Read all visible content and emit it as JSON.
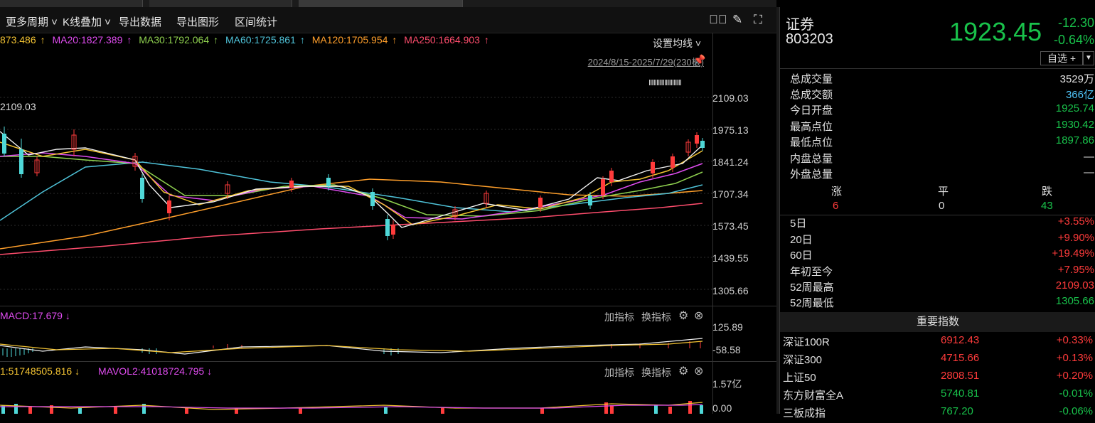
{
  "toolbar": {
    "items": [
      "更多周期",
      "K线叠加",
      "导出数据",
      "导出图形",
      "区间统计"
    ],
    "icons": [
      "chevron-circle-icon",
      "brush-icon",
      "expand-icon"
    ]
  },
  "ma": {
    "ma10": "873.486",
    "ma20": "MA20:1827.389",
    "ma30": "MA30:1792.064",
    "ma60": "MA60:1725.861",
    "ma120": "MA120:1705.954",
    "ma250": "MA250:1664.903",
    "setting": "设置均线",
    "colors": {
      "ma10": "#f2c232",
      "ma20": "#e04cf0",
      "ma30": "#8fd14f",
      "ma60": "#4fc3d9",
      "ma120": "#ff9f2b",
      "ma250": "#ff4d6d"
    }
  },
  "range_label": "2024/8/15-2025/7/29(230根)",
  "high_marker": "2109.03",
  "y_ticks": [
    "2109.03",
    "1975.13",
    "1841.24",
    "1707.34",
    "1573.45",
    "1439.55",
    "1305.66"
  ],
  "macd": {
    "label": "MACD:17.679",
    "arrow": "↓",
    "ticks": [
      "125.89",
      "-58.58"
    ]
  },
  "vol": {
    "label1": "1:51748505.816",
    "label2": "MAVOL2:41018724.795",
    "ticks": [
      "1.57亿",
      "0.00"
    ]
  },
  "sub_buttons": {
    "add": "加指标",
    "switch": "换指标"
  },
  "panel": {
    "name": "证券",
    "code": "803203",
    "price": "1923.45",
    "change": "-12.30",
    "change_pct": "-0.64%",
    "watch": "自选 +",
    "stats": [
      {
        "label": "总成交量",
        "value": "3529万",
        "color": "#e0e0e0"
      },
      {
        "label": "总成交额",
        "value": "366亿",
        "color": "#4fc3f7"
      },
      {
        "label": "今日开盘",
        "value": "1925.74",
        "color": "#19c24b"
      },
      {
        "label": "最高点位",
        "value": "1930.42",
        "color": "#19c24b"
      },
      {
        "label": "最低点位",
        "value": "1897.86",
        "color": "#19c24b"
      },
      {
        "label": "内盘总量",
        "value": "—",
        "color": "#e0e0e0"
      },
      {
        "label": "外盘总量",
        "value": "—",
        "color": "#e0e0e0"
      }
    ],
    "breadth": {
      "up_label": "涨",
      "flat_label": "平",
      "down_label": "跌",
      "up": "6",
      "flat": "0",
      "down": "43"
    },
    "perf": [
      {
        "label": "5日",
        "value": "+3.55%"
      },
      {
        "label": "20日",
        "value": "+9.90%"
      },
      {
        "label": "60日",
        "value": "+19.49%"
      },
      {
        "label": "年初至今",
        "value": "+7.95%"
      },
      {
        "label": "52周最高",
        "value": "2109.03"
      },
      {
        "label": "52周最低",
        "value": "1305.66"
      }
    ],
    "index_header": "重要指数",
    "indices": [
      {
        "name": "深证100R",
        "price": "6912.43",
        "chg": "+0.33%",
        "color": "#ff3b3b"
      },
      {
        "name": "深证300",
        "price": "4715.66",
        "chg": "+0.13%",
        "color": "#ff3b3b"
      },
      {
        "name": "上证50",
        "price": "2808.51",
        "chg": "+0.20%",
        "color": "#ff3b3b"
      },
      {
        "name": "东方财富全A",
        "price": "5740.81",
        "chg": "-0.01%",
        "color": "#19c24b"
      },
      {
        "name": "三板成指",
        "price": "767.20",
        "chg": "-0.06%",
        "color": "#19c24b"
      }
    ]
  }
}
